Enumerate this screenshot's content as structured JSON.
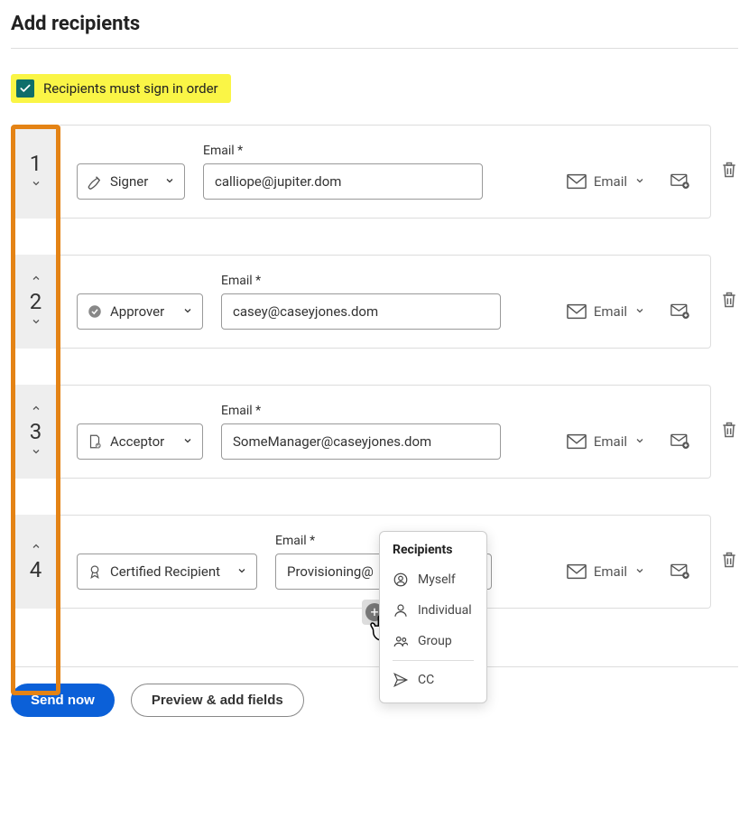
{
  "page_title": "Add recipients",
  "sign_order": {
    "checked": true,
    "label": "Recipients must sign in order"
  },
  "email_label": "Email  *",
  "delivery_label": "Email",
  "recipients": [
    {
      "order": "1",
      "role": "Signer",
      "email": "calliope@jupiter.dom",
      "show_up": false,
      "show_down": true
    },
    {
      "order": "2",
      "role": "Approver",
      "email": "casey@caseyjones.dom",
      "show_up": true,
      "show_down": true
    },
    {
      "order": "3",
      "role": "Acceptor",
      "email": "SomeManager@caseyjones.dom",
      "show_up": true,
      "show_down": true
    },
    {
      "order": "4",
      "role": "Certified Recipient",
      "email": "Provisioning@",
      "show_up": true,
      "show_down": false,
      "wide_role": true
    }
  ],
  "popover": {
    "title": "Recipients",
    "items": [
      "Myself",
      "Individual",
      "Group"
    ],
    "cc": "CC"
  },
  "footer": {
    "primary": "Send now",
    "secondary": "Preview & add fields"
  }
}
